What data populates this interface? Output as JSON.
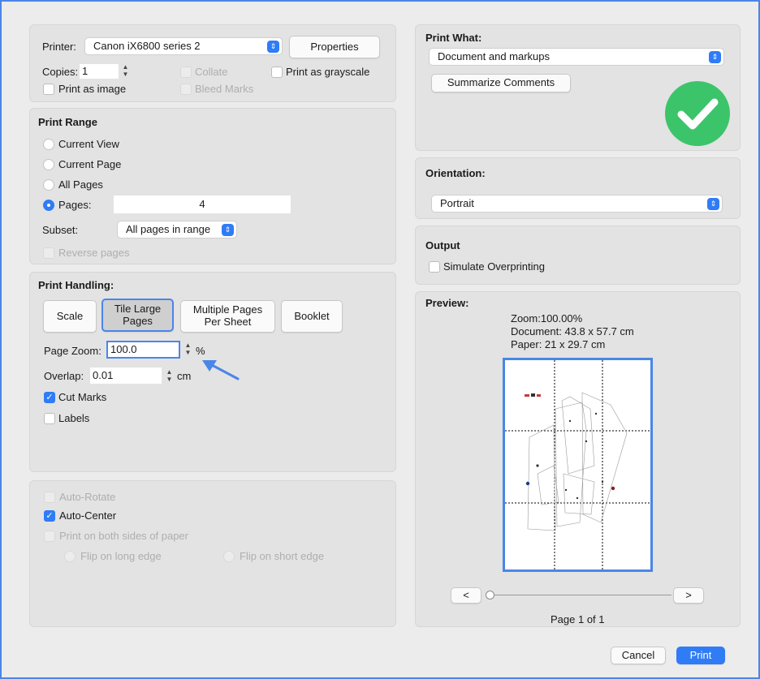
{
  "printer": {
    "label": "Printer:",
    "selected": "Canon iX6800 series 2",
    "properties_label": "Properties"
  },
  "copies": {
    "label": "Copies:",
    "value": "1"
  },
  "options": {
    "collate": "Collate",
    "print_grayscale": "Print as grayscale",
    "print_as_image": "Print as image",
    "bleed_marks": "Bleed Marks"
  },
  "print_range": {
    "title": "Print Range",
    "current_view": "Current View",
    "current_page": "Current Page",
    "all_pages": "All Pages",
    "pages_label": "Pages:",
    "pages_value": "4",
    "subset_label": "Subset:",
    "subset_value": "All pages in range",
    "reverse_pages": "Reverse pages"
  },
  "print_handling": {
    "title": "Print Handling:",
    "scale": "Scale",
    "tile_large_pages": "Tile Large Pages",
    "multiple_pages": "Multiple Pages Per Sheet",
    "booklet": "Booklet",
    "page_zoom_label": "Page Zoom:",
    "page_zoom_value": "100.0",
    "page_zoom_unit": "%",
    "overlap_label": "Overlap:",
    "overlap_value": "0.01",
    "overlap_unit": "cm",
    "cut_marks": "Cut Marks",
    "labels": "Labels"
  },
  "layout_opts": {
    "auto_rotate": "Auto-Rotate",
    "auto_center": "Auto-Center",
    "both_sides": "Print on both sides of paper",
    "flip_long": "Flip on long edge",
    "flip_short": "Flip on short edge"
  },
  "print_what": {
    "title": "Print What:",
    "selected": "Document and markups",
    "summarize": "Summarize Comments"
  },
  "orientation": {
    "title": "Orientation:",
    "selected": "Portrait"
  },
  "output": {
    "title": "Output",
    "simulate": "Simulate Overprinting"
  },
  "preview": {
    "title": "Preview:",
    "zoom": "Zoom:100.00%",
    "document": "Document: 43.8 x 57.7 cm",
    "paper": "Paper: 21 x 29.7 cm",
    "prev": "<",
    "next": ">",
    "page_info": "Page 1 of 1"
  },
  "footer": {
    "cancel": "Cancel",
    "print": "Print"
  },
  "colors": {
    "accent": "#2f7cf6",
    "success": "#3cc46b",
    "annotation": "#4a86e8"
  }
}
